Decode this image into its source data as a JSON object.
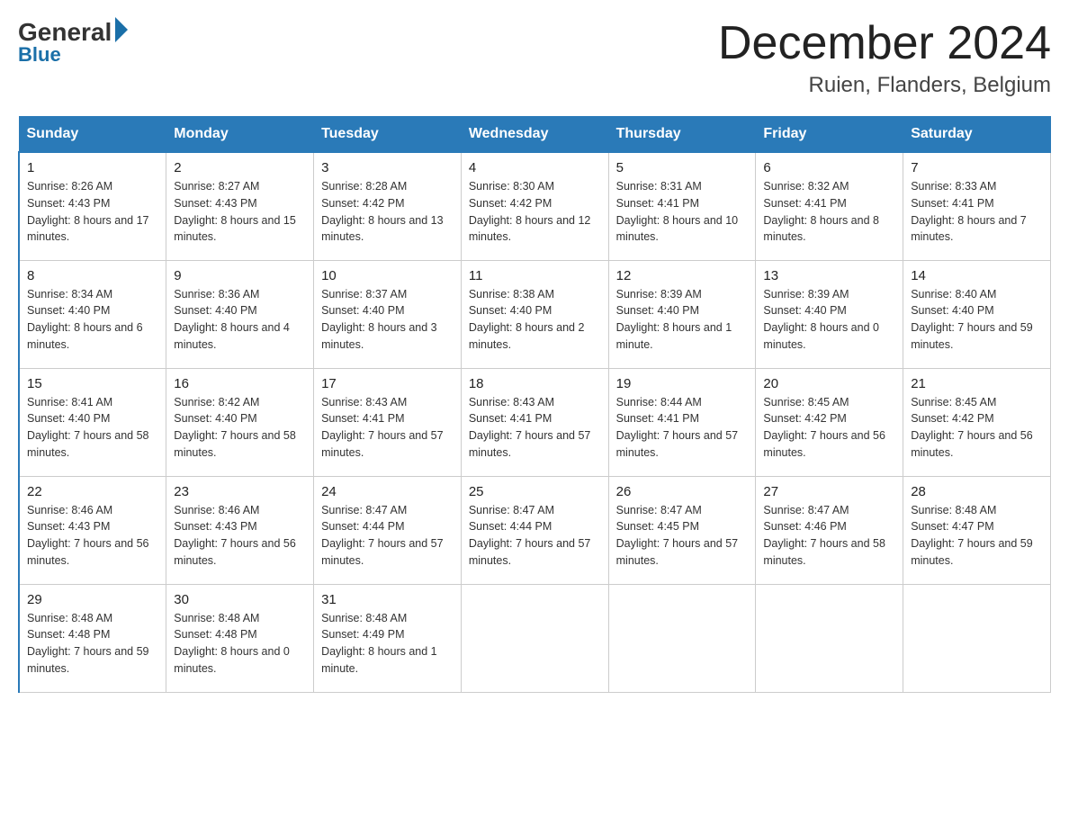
{
  "logo": {
    "general": "General",
    "blue": "Blue"
  },
  "title": "December 2024",
  "location": "Ruien, Flanders, Belgium",
  "days_of_week": [
    "Sunday",
    "Monday",
    "Tuesday",
    "Wednesday",
    "Thursday",
    "Friday",
    "Saturday"
  ],
  "weeks": [
    [
      {
        "day": "1",
        "sunrise": "8:26 AM",
        "sunset": "4:43 PM",
        "daylight": "8 hours and 17 minutes."
      },
      {
        "day": "2",
        "sunrise": "8:27 AM",
        "sunset": "4:43 PM",
        "daylight": "8 hours and 15 minutes."
      },
      {
        "day": "3",
        "sunrise": "8:28 AM",
        "sunset": "4:42 PM",
        "daylight": "8 hours and 13 minutes."
      },
      {
        "day": "4",
        "sunrise": "8:30 AM",
        "sunset": "4:42 PM",
        "daylight": "8 hours and 12 minutes."
      },
      {
        "day": "5",
        "sunrise": "8:31 AM",
        "sunset": "4:41 PM",
        "daylight": "8 hours and 10 minutes."
      },
      {
        "day": "6",
        "sunrise": "8:32 AM",
        "sunset": "4:41 PM",
        "daylight": "8 hours and 8 minutes."
      },
      {
        "day": "7",
        "sunrise": "8:33 AM",
        "sunset": "4:41 PM",
        "daylight": "8 hours and 7 minutes."
      }
    ],
    [
      {
        "day": "8",
        "sunrise": "8:34 AM",
        "sunset": "4:40 PM",
        "daylight": "8 hours and 6 minutes."
      },
      {
        "day": "9",
        "sunrise": "8:36 AM",
        "sunset": "4:40 PM",
        "daylight": "8 hours and 4 minutes."
      },
      {
        "day": "10",
        "sunrise": "8:37 AM",
        "sunset": "4:40 PM",
        "daylight": "8 hours and 3 minutes."
      },
      {
        "day": "11",
        "sunrise": "8:38 AM",
        "sunset": "4:40 PM",
        "daylight": "8 hours and 2 minutes."
      },
      {
        "day": "12",
        "sunrise": "8:39 AM",
        "sunset": "4:40 PM",
        "daylight": "8 hours and 1 minute."
      },
      {
        "day": "13",
        "sunrise": "8:39 AM",
        "sunset": "4:40 PM",
        "daylight": "8 hours and 0 minutes."
      },
      {
        "day": "14",
        "sunrise": "8:40 AM",
        "sunset": "4:40 PM",
        "daylight": "7 hours and 59 minutes."
      }
    ],
    [
      {
        "day": "15",
        "sunrise": "8:41 AM",
        "sunset": "4:40 PM",
        "daylight": "7 hours and 58 minutes."
      },
      {
        "day": "16",
        "sunrise": "8:42 AM",
        "sunset": "4:40 PM",
        "daylight": "7 hours and 58 minutes."
      },
      {
        "day": "17",
        "sunrise": "8:43 AM",
        "sunset": "4:41 PM",
        "daylight": "7 hours and 57 minutes."
      },
      {
        "day": "18",
        "sunrise": "8:43 AM",
        "sunset": "4:41 PM",
        "daylight": "7 hours and 57 minutes."
      },
      {
        "day": "19",
        "sunrise": "8:44 AM",
        "sunset": "4:41 PM",
        "daylight": "7 hours and 57 minutes."
      },
      {
        "day": "20",
        "sunrise": "8:45 AM",
        "sunset": "4:42 PM",
        "daylight": "7 hours and 56 minutes."
      },
      {
        "day": "21",
        "sunrise": "8:45 AM",
        "sunset": "4:42 PM",
        "daylight": "7 hours and 56 minutes."
      }
    ],
    [
      {
        "day": "22",
        "sunrise": "8:46 AM",
        "sunset": "4:43 PM",
        "daylight": "7 hours and 56 minutes."
      },
      {
        "day": "23",
        "sunrise": "8:46 AM",
        "sunset": "4:43 PM",
        "daylight": "7 hours and 56 minutes."
      },
      {
        "day": "24",
        "sunrise": "8:47 AM",
        "sunset": "4:44 PM",
        "daylight": "7 hours and 57 minutes."
      },
      {
        "day": "25",
        "sunrise": "8:47 AM",
        "sunset": "4:44 PM",
        "daylight": "7 hours and 57 minutes."
      },
      {
        "day": "26",
        "sunrise": "8:47 AM",
        "sunset": "4:45 PM",
        "daylight": "7 hours and 57 minutes."
      },
      {
        "day": "27",
        "sunrise": "8:47 AM",
        "sunset": "4:46 PM",
        "daylight": "7 hours and 58 minutes."
      },
      {
        "day": "28",
        "sunrise": "8:48 AM",
        "sunset": "4:47 PM",
        "daylight": "7 hours and 59 minutes."
      }
    ],
    [
      {
        "day": "29",
        "sunrise": "8:48 AM",
        "sunset": "4:48 PM",
        "daylight": "7 hours and 59 minutes."
      },
      {
        "day": "30",
        "sunrise": "8:48 AM",
        "sunset": "4:48 PM",
        "daylight": "8 hours and 0 minutes."
      },
      {
        "day": "31",
        "sunrise": "8:48 AM",
        "sunset": "4:49 PM",
        "daylight": "8 hours and 1 minute."
      },
      null,
      null,
      null,
      null
    ]
  ]
}
